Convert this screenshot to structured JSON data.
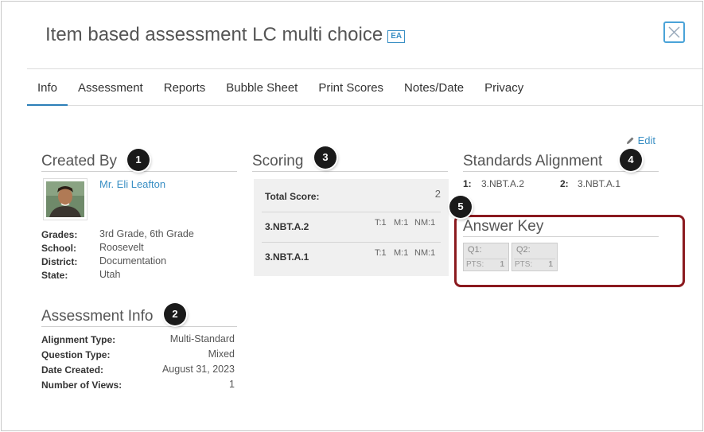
{
  "header": {
    "title": "Item based assessment LC multi choice",
    "badge": "EA",
    "close_icon": "close-x-icon"
  },
  "tabs": [
    {
      "label": "Info",
      "active": true
    },
    {
      "label": "Assessment"
    },
    {
      "label": "Reports"
    },
    {
      "label": "Bubble Sheet"
    },
    {
      "label": "Print Scores"
    },
    {
      "label": "Notes/Date"
    },
    {
      "label": "Privacy"
    }
  ],
  "created_by": {
    "title": "Created By",
    "callout": "1",
    "name": "Mr. Eli Leafton",
    "fields": [
      {
        "label": "Grades:",
        "value": "3rd Grade, 6th Grade",
        "link": false
      },
      {
        "label": "School:",
        "value": "Roosevelt",
        "link": true
      },
      {
        "label": "District:",
        "value": "Documentation",
        "link": true
      },
      {
        "label": "State:",
        "value": "Utah",
        "link": false
      }
    ]
  },
  "assessment_info": {
    "title": "Assessment Info",
    "callout": "2",
    "fields": [
      {
        "label": "Alignment Type:",
        "value": "Multi-Standard"
      },
      {
        "label": "Question Type:",
        "value": "Mixed"
      },
      {
        "label": "Date Created:",
        "value": "August 31, 2023"
      },
      {
        "label": "Number of Views:",
        "value": "1"
      }
    ]
  },
  "scoring": {
    "title": "Scoring",
    "callout": "3",
    "total_label": "Total Score:",
    "total_value": "2",
    "rows": [
      {
        "name": "3.NBT.A.2",
        "t": "T:1",
        "m": "M:1",
        "nm": "NM:1"
      },
      {
        "name": "3.NBT.A.1",
        "t": "T:1",
        "m": "M:1",
        "nm": "NM:1"
      }
    ]
  },
  "standards": {
    "edit_label": "Edit",
    "title": "Standards Alignment",
    "callout": "4",
    "items": [
      {
        "num": "1:",
        "code": "3.NBT.A.2"
      },
      {
        "num": "2:",
        "code": "3.NBT.A.1"
      }
    ]
  },
  "answer_key": {
    "title": "Answer Key",
    "callout": "5",
    "highlight_color": "#8b1a1f",
    "items": [
      {
        "q": "Q1:",
        "pts_label": "PTS:",
        "pts": "1"
      },
      {
        "q": "Q2:",
        "pts_label": "PTS:",
        "pts": "1"
      }
    ]
  }
}
